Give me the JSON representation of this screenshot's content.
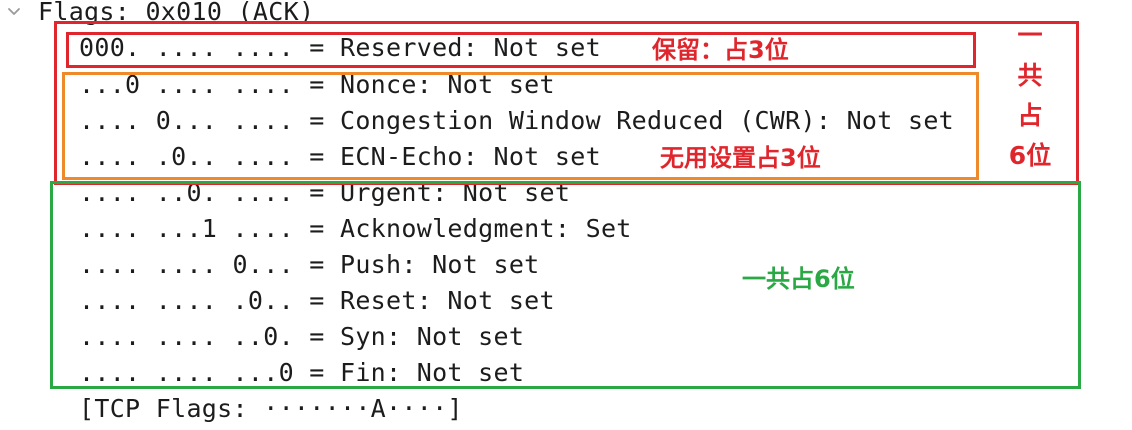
{
  "flags_header": "Flags: 0x010 (ACK)",
  "rows": [
    "000. .... .... = Reserved: Not set",
    "...0 .... .... = Nonce: Not set",
    ".... 0... .... = Congestion Window Reduced (CWR): Not set",
    ".... .0.. .... = ECN-Echo: Not set",
    ".... ..0. .... = Urgent: Not set",
    ".... ...1 .... = Acknowledgment: Set",
    ".... .... 0... = Push: Not set",
    ".... .... .0.. = Reset: Not set",
    ".... .... ..0. = Syn: Not set",
    ".... .... ...0 = Fin: Not set"
  ],
  "tcp_flags_summary": "[TCP Flags: ·······A····]",
  "annotations": {
    "reserved_note": "保留：占3位",
    "unused_note": "无用设置占3位",
    "red_vertical": [
      "一",
      "共",
      "占",
      "6位"
    ],
    "green_note": "一共占6位"
  },
  "icons": {
    "expand": "chevron-down-icon"
  },
  "colors": {
    "red": "#e0262d",
    "orange": "#ef8a2b",
    "green": "#2aa844",
    "text": "#1c1c1c"
  }
}
